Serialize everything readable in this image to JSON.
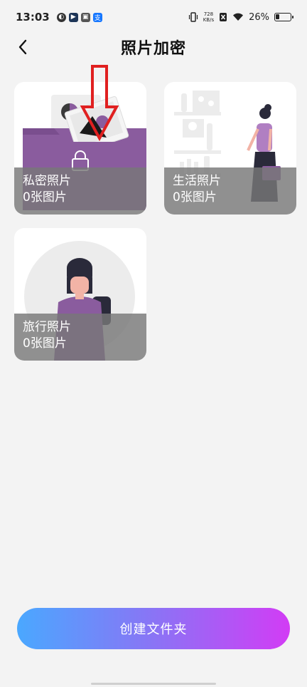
{
  "status_bar": {
    "time": "13:03",
    "net_speed_value": "728",
    "net_speed_unit": "KB/s",
    "battery": "26%",
    "icons": [
      "app-icon-1",
      "app-icon-2",
      "app-icon-3",
      "alipay-icon",
      "vibrate-icon",
      "no-sim-icon",
      "wifi-icon",
      "battery-icon"
    ]
  },
  "header": {
    "title": "照片加密",
    "back_icon": "chevron-left-icon"
  },
  "albums": [
    {
      "name": "私密照片",
      "count": "0张图片"
    },
    {
      "name": "生活照片",
      "count": "0张图片"
    },
    {
      "name": "旅行照片",
      "count": "0张图片"
    }
  ],
  "create_button": {
    "label": "创建文件夹"
  },
  "colors": {
    "accent_purple": "#8a5c9e",
    "annotation_red": "#e02020",
    "button_gradient_start": "#4aa8ff",
    "button_gradient_end": "#d23cf5"
  }
}
